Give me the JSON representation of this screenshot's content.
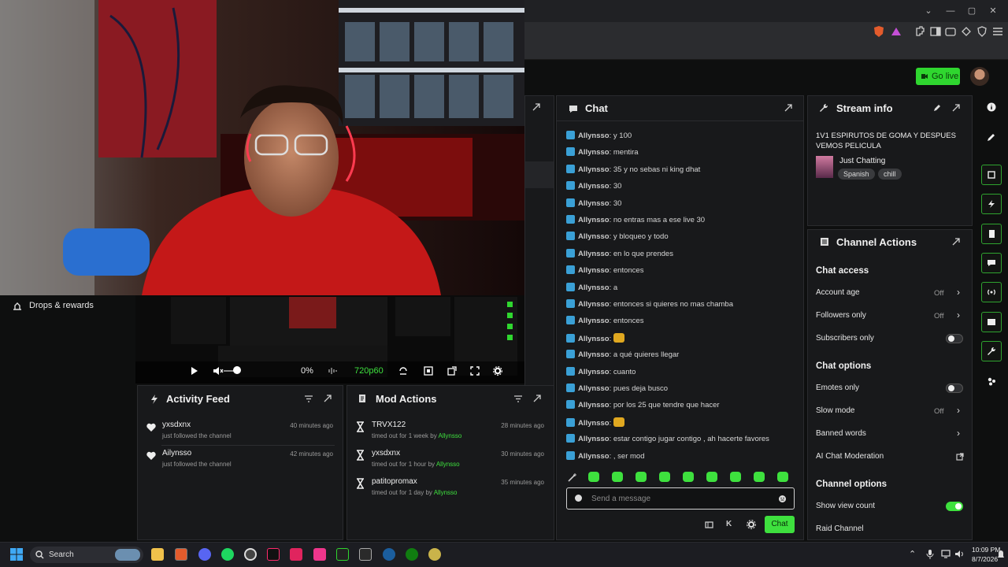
{
  "nav": {
    "go_live": "Go live"
  },
  "sidebar": {
    "drops": "Drops & rewards"
  },
  "player": {
    "volume": "0%",
    "quality": "720p60"
  },
  "activity_feed": {
    "title": "Activity Feed",
    "items": [
      {
        "name": "yxsdxnx",
        "desc": "just followed the channel",
        "time": "40 minutes ago"
      },
      {
        "name": "Ailynsso",
        "desc": "just followed the channel",
        "time": "42 minutes ago"
      }
    ]
  },
  "mod_actions": {
    "title": "Mod Actions",
    "items": [
      {
        "name": "TRVX122",
        "desc": "timed out for 1 week by",
        "by": "Allynsso",
        "time": "28 minutes ago"
      },
      {
        "name": "yxsdxnx",
        "desc": "timed out for 1 hour by",
        "by": "Allynsso",
        "time": "30 minutes ago"
      },
      {
        "name": "patitopromax",
        "desc": "timed out for 1 day by",
        "by": "Allynsso",
        "time": "35 minutes ago"
      }
    ]
  },
  "chat": {
    "title": "Chat",
    "messages": [
      {
        "user": "Allynsso",
        "text": "y 100"
      },
      {
        "user": "Allynsso",
        "text": "mentira"
      },
      {
        "user": "Allynsso",
        "text": "35 y no sebas ni king dhat"
      },
      {
        "user": "Allynsso",
        "text": "30"
      },
      {
        "user": "Allynsso",
        "text": "30"
      },
      {
        "user": "Allynsso",
        "text": "no entras mas a ese live 30"
      },
      {
        "user": "Allynsso",
        "text": "y bloqueo y todo"
      },
      {
        "user": "Allynsso",
        "text": "en lo que prendes"
      },
      {
        "user": "Allynsso",
        "text": "entonces"
      },
      {
        "user": "Allynsso",
        "text": "a"
      },
      {
        "user": "Allynsso",
        "text": "entonces si quieres no mas chamba"
      },
      {
        "user": "Allynsso",
        "text": "entonces"
      },
      {
        "user": "Allynsso",
        "text": ""
      },
      {
        "user": "Allynsso",
        "text": "a qué quieres llegar"
      },
      {
        "user": "Allynsso",
        "text": "cuanto"
      },
      {
        "user": "Allynsso",
        "text": "pues deja busco"
      },
      {
        "user": "Allynsso",
        "text": "por los 25 que tendre que hacer"
      },
      {
        "user": "Allynsso",
        "text": ""
      },
      {
        "user": "Allynsso",
        "text": "estar contigo jugar contigo , ah hacerte favores"
      },
      {
        "user": "Allynsso",
        "text": ", ser mod"
      }
    ],
    "placeholder": "Send a message",
    "send": "Chat"
  },
  "stream_info": {
    "title": "Stream info",
    "stream_title": "1V1 ESPIRUTOS DE GOMA Y DESPUES VEMOS PELICULA",
    "category": "Just Chatting",
    "tags": [
      "Spanish",
      "chill"
    ]
  },
  "channel_actions": {
    "title": "Channel Actions",
    "chat_access": "Chat access",
    "account_age": "Account age",
    "account_age_val": "Off",
    "followers_only": "Followers only",
    "followers_only_val": "Off",
    "subscribers_only": "Subscribers only",
    "chat_options": "Chat options",
    "emotes_only": "Emotes only",
    "slow_mode": "Slow mode",
    "slow_mode_val": "Off",
    "banned_words": "Banned words",
    "ai_moderation": "AI Chat Moderation",
    "channel_options": "Channel options",
    "show_view_count": "Show view count",
    "raid_channel": "Raid Channel"
  },
  "taskbar": {
    "search": "Search",
    "time": "10:09 PM",
    "date": "8/7/2026"
  },
  "colors": {
    "accent": "#3ee03e",
    "badge": "#3aa0d6",
    "panel": "#18191b"
  }
}
